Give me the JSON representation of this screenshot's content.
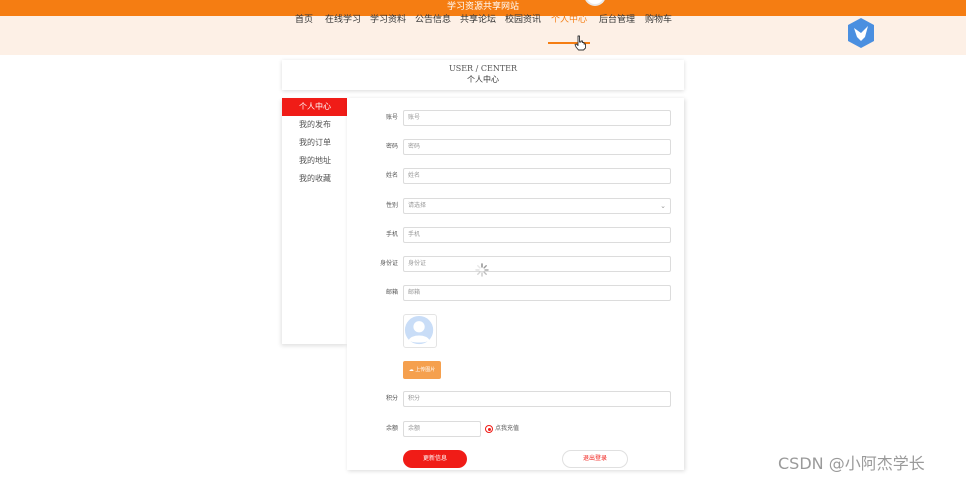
{
  "site": {
    "title": "学习资源共享网站"
  },
  "nav": {
    "items": [
      {
        "label": "首页"
      },
      {
        "label": "在线学习"
      },
      {
        "label": "学习资料"
      },
      {
        "label": "公告信息"
      },
      {
        "label": "共享论坛"
      },
      {
        "label": "校园资讯"
      },
      {
        "label": "个人中心",
        "active": true
      },
      {
        "label": "后台管理"
      },
      {
        "label": "购物车"
      }
    ]
  },
  "header": {
    "title_en": "USER / CENTER",
    "title_cn": "个人中心"
  },
  "sidebar": {
    "items": [
      {
        "label": "个人中心",
        "active": true
      },
      {
        "label": "我的发布"
      },
      {
        "label": "我的订单"
      },
      {
        "label": "我的地址"
      },
      {
        "label": "我的收藏"
      }
    ]
  },
  "form": {
    "fields": [
      {
        "label": "账号",
        "placeholder": "账号"
      },
      {
        "label": "密码",
        "placeholder": "密码"
      },
      {
        "label": "姓名",
        "placeholder": "姓名"
      },
      {
        "label": "性别",
        "placeholder": "请选择"
      },
      {
        "label": "手机",
        "placeholder": "手机"
      },
      {
        "label": "身份证",
        "placeholder": "身份证"
      },
      {
        "label": "邮箱",
        "placeholder": "邮箱"
      },
      {
        "label": "积分",
        "placeholder": "积分"
      },
      {
        "label": "余额",
        "placeholder": "余额"
      }
    ],
    "upload_label": "上传图片",
    "recharge_label": "点我充值",
    "update_label": "更新信息",
    "logout_label": "退出登录"
  },
  "watermark": "CSDN @小阿杰学长",
  "colors": {
    "brand_orange": "#f57d12",
    "accent_red": "#f01c17",
    "nav_bg": "#fdf0e6"
  }
}
